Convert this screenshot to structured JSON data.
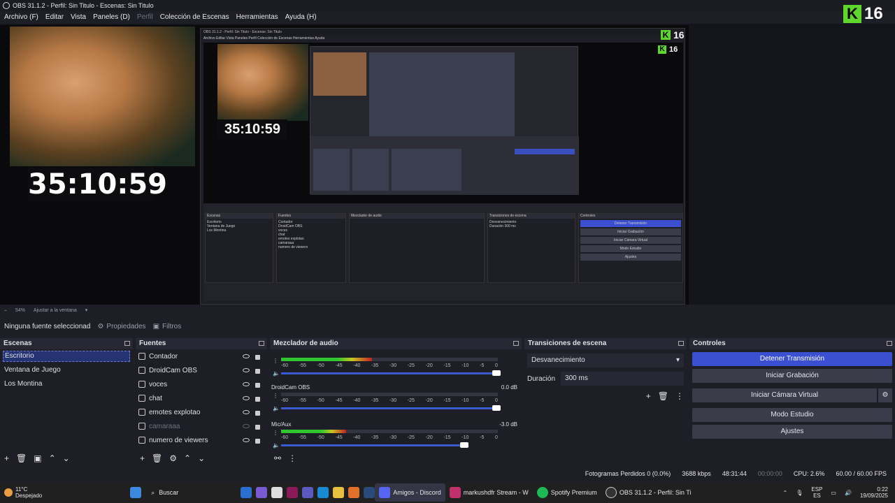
{
  "titlebar": {
    "text": "OBS 31.1.2 - Perfil: Sin Titulo - Escenas: Sin Titulo"
  },
  "menu": [
    "Archivo (F)",
    "Editar",
    "Vista",
    "Paneles (D)",
    "Perfil",
    "Colección de Escenas",
    "Herramientas",
    "Ayuda (H)"
  ],
  "preview": {
    "clock": "35:10:59",
    "badge_num": "16",
    "badge_letter": "K"
  },
  "zoom": {
    "value": "54%",
    "fit": "Ajustar a la ventana"
  },
  "context": {
    "no_source": "Ninguna fuente seleccionad",
    "properties": "Propiedades",
    "filters": "Filtros"
  },
  "scenes": {
    "title": "Escenas",
    "items": [
      "Escritorio",
      "Ventana de Juego",
      "Los Montina"
    ]
  },
  "sources": {
    "title": "Fuentes",
    "items": [
      "Contador",
      "DroidCam OBS",
      "voces",
      "chat",
      "emotes explotao",
      "camaraaa",
      "numero de viewers"
    ]
  },
  "mixer": {
    "title": "Mezclador de audio",
    "scale": [
      "-60",
      "-55",
      "-50",
      "-45",
      "-40",
      "-35",
      "-30",
      "-25",
      "-20",
      "-15",
      "-10",
      "-5",
      "0"
    ],
    "channels": [
      {
        "name": "",
        "db": "",
        "level": 0.42,
        "volume": 1.0
      },
      {
        "name": "DroidCam OBS",
        "db": "0.0 dB",
        "level": 0.0,
        "volume": 1.0
      },
      {
        "name": "Mic/Aux",
        "db": "-3.0 dB",
        "level": 0.3,
        "volume": 0.85
      }
    ]
  },
  "transitions": {
    "title": "Transiciones de escena",
    "selected": "Desvanecimiento",
    "duration_label": "Duración",
    "duration": "300 ms"
  },
  "controls": {
    "title": "Controles",
    "buttons": [
      "Detener Transmisión",
      "Iniciar Grabación",
      "Iniciar Cámara Virtual",
      "Modo Estudio",
      "Ajustes"
    ]
  },
  "status": {
    "frames": "Fotogramas Perdidos 0 (0.0%)",
    "bitrate": "3688 kbps",
    "live_time": "48:31:44",
    "rec_time": "00:00:00",
    "cpu": "CPU: 2.6%",
    "fps": "60.00 / 60.00 FPS"
  },
  "taskbar": {
    "weather_temp": "11°C",
    "weather_desc": "Despejado",
    "search": "Buscar",
    "apps": [
      "Amigos - Discord",
      "markushdfr Stream - W",
      "Spotify Premium",
      "OBS 31.1.2 - Perfil: Sin Ti"
    ],
    "lang": "ESP",
    "lang2": "ES",
    "time": "0:22",
    "date": "19/09/2025"
  },
  "colors": {
    "accent": "#3b50d0",
    "meter_green": "#2fc62f",
    "logo_green": "#5fd62c"
  }
}
